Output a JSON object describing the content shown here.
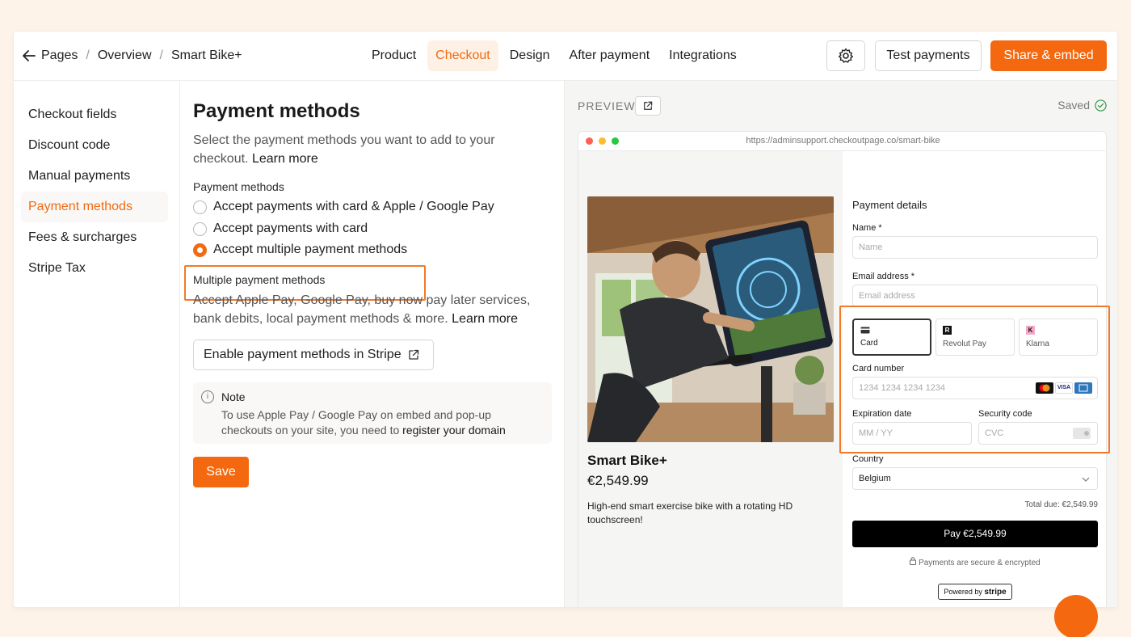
{
  "breadcrumb": [
    "Pages",
    "Overview",
    "Smart Bike+"
  ],
  "tabs": [
    {
      "label": "Product",
      "active": false
    },
    {
      "label": "Checkout",
      "active": true
    },
    {
      "label": "Design",
      "active": false
    },
    {
      "label": "After payment",
      "active": false
    },
    {
      "label": "Integrations",
      "active": false
    }
  ],
  "header_actions": {
    "test": "Test payments",
    "share": "Share & embed"
  },
  "sidebar": [
    {
      "label": "Checkout fields",
      "active": false
    },
    {
      "label": "Discount code",
      "active": false
    },
    {
      "label": "Manual payments",
      "active": false
    },
    {
      "label": "Payment methods",
      "active": true
    },
    {
      "label": "Fees & surcharges",
      "active": false
    },
    {
      "label": "Stripe Tax",
      "active": false
    }
  ],
  "main": {
    "title": "Payment methods",
    "lead": "Select the payment methods you want to add to your checkout.",
    "lead_link": "Learn more",
    "section_label": "Payment methods",
    "options": [
      {
        "label": "Accept payments with card & Apple / Google Pay",
        "selected": false
      },
      {
        "label": "Accept payments with card",
        "selected": false
      },
      {
        "label": "Accept multiple payment methods",
        "selected": true
      }
    ],
    "multi_label": "Multiple payment methods",
    "multi_desc": "Accept Apple Pay, Google Pay, buy now pay later services, bank debits, local payment methods & more.",
    "multi_link": "Learn more",
    "stripe_button": "Enable payment methods in Stripe",
    "note_title": "Note",
    "note_text": "To use Apple Pay / Google Pay on embed and pop-up checkouts on your site, you need to",
    "note_link": "register your domain",
    "save": "Save"
  },
  "preview": {
    "label": "PREVIEW",
    "saved": "Saved",
    "url": "https://adminsupport.checkoutpage.co/smart-bike",
    "product_name": "Smart Bike+",
    "price": "€2,549.99",
    "description": "High-end smart exercise bike with a rotating HD touchscreen!",
    "payment_title": "Payment details",
    "name_label": "Name *",
    "name_placeholder": "Name",
    "email_label": "Email address *",
    "email_placeholder": "Email address",
    "methods": [
      {
        "label": "Card",
        "icon": "R",
        "active": true
      },
      {
        "label": "Revolut Pay",
        "icon": "R",
        "active": false
      },
      {
        "label": "Klarna",
        "icon": "K",
        "active": false
      }
    ],
    "card_number_label": "Card number",
    "card_number_placeholder": "1234 1234 1234 1234",
    "card_brands": [
      "VISA"
    ],
    "expiry_label": "Expiration date",
    "expiry_placeholder": "MM / YY",
    "cvc_label": "Security code",
    "cvc_placeholder": "CVC",
    "country_label": "Country",
    "country_value": "Belgium",
    "total": "Total due: €2,549.99",
    "pay_button": "Pay €2,549.99",
    "secure": "Payments are secure & encrypted",
    "powered": "Powered by",
    "powered_brand": "stripe"
  },
  "colors": {
    "accent": "#f4690f",
    "accent_text": "#f06a12",
    "highlight": "#f07a2a",
    "background": "#fdf3e9"
  }
}
